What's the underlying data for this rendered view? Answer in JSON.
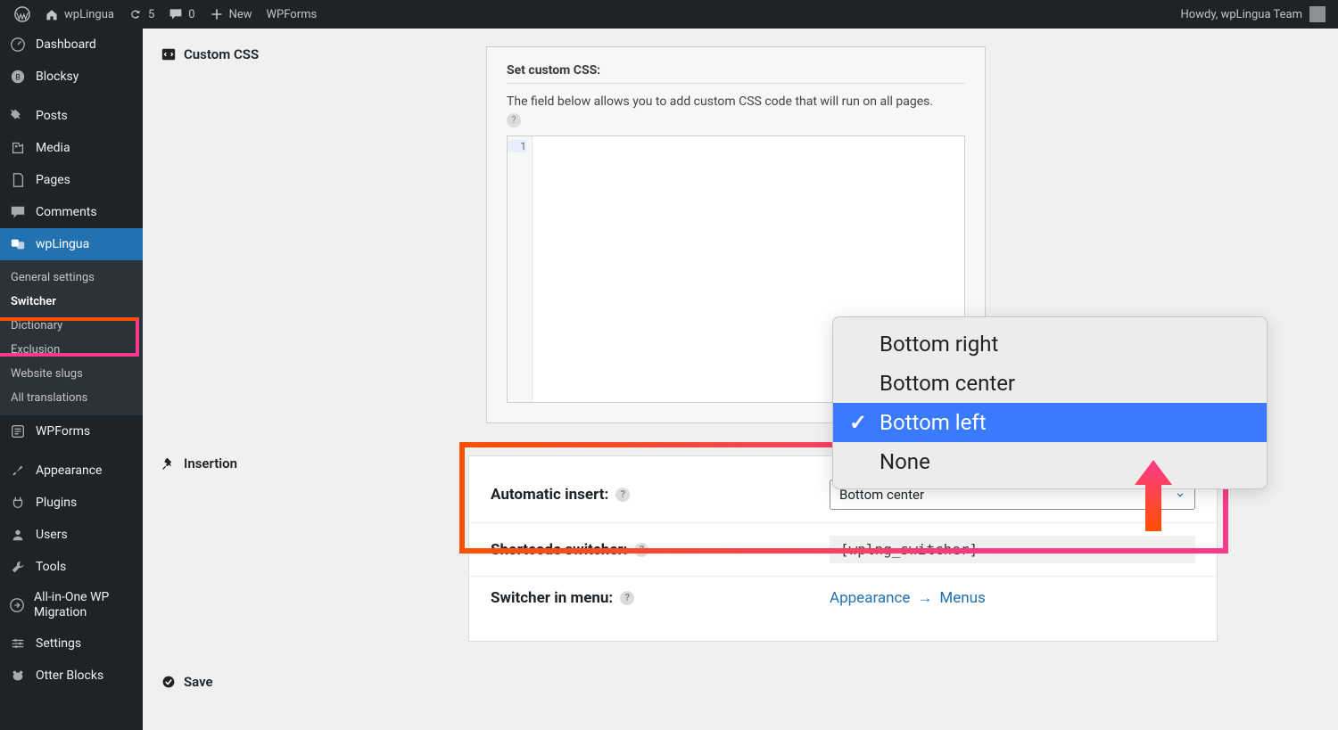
{
  "adminbar": {
    "site": "wpLingua",
    "updates": "5",
    "comments": "0",
    "new": "New",
    "wpforms": "WPForms",
    "howdy": "Howdy, wpLingua Team"
  },
  "sidebar": {
    "items": [
      {
        "label": "Dashboard",
        "icon": "dashboard"
      },
      {
        "label": "Blocksy",
        "icon": "blocksy"
      },
      {
        "label": "Posts",
        "icon": "pin"
      },
      {
        "label": "Media",
        "icon": "media"
      },
      {
        "label": "Pages",
        "icon": "page"
      },
      {
        "label": "Comments",
        "icon": "comment"
      },
      {
        "label": "wpLingua",
        "icon": "translate",
        "active": true
      },
      {
        "label": "WPForms",
        "icon": "form"
      },
      {
        "label": "Appearance",
        "icon": "brush"
      },
      {
        "label": "Plugins",
        "icon": "plug"
      },
      {
        "label": "Users",
        "icon": "user"
      },
      {
        "label": "Tools",
        "icon": "wrench"
      },
      {
        "label": "All-in-One WP Migration",
        "icon": "migrate"
      },
      {
        "label": "Settings",
        "icon": "sliders"
      },
      {
        "label": "Otter Blocks",
        "icon": "otter"
      }
    ],
    "submenu": [
      "General settings",
      "Switcher",
      "Dictionary",
      "Exclusion",
      "Website slugs",
      "All translations"
    ]
  },
  "sections": {
    "custom_css": {
      "heading": "Custom CSS",
      "box_title": "Set custom CSS:",
      "desc": "The field below allows you to add custom CSS code that will run on all pages.",
      "line1": "1"
    },
    "insertion": {
      "heading": "Insertion",
      "auto_label": "Automatic insert:",
      "auto_value": "Bottom center",
      "shortcode_label": "Shortcode switcher:",
      "shortcode_value": "[wplng_switcher]",
      "switcher_menu_label": "Switcher in menu:",
      "switcher_menu_link_a": "Appearance",
      "switcher_menu_link_b": "Menus"
    },
    "save": {
      "heading": "Save"
    }
  },
  "dropdown": {
    "options": [
      "Bottom right",
      "Bottom center",
      "Bottom left",
      "None"
    ],
    "selected": "Bottom left"
  },
  "colors": {
    "primary": "#2271b1",
    "highlight_a": "#fd5000",
    "highlight_b": "#fc3a8b",
    "popup_sel": "#3a7afe"
  }
}
